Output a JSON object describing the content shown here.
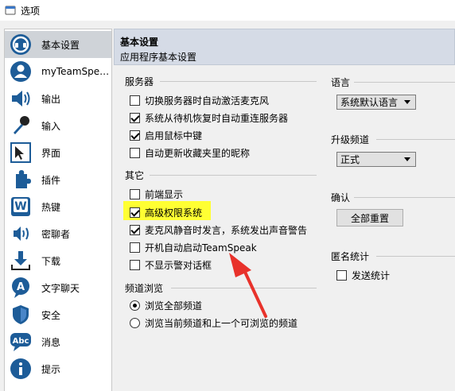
{
  "window": {
    "title": "选项"
  },
  "sidebar": {
    "items": [
      {
        "label": "基本设置",
        "icon": "teamspeak-logo-icon",
        "selected": true
      },
      {
        "label": "myTeamSpe…",
        "icon": "user-avatar-icon"
      },
      {
        "label": "输出",
        "icon": "speaker-icon"
      },
      {
        "label": "输入",
        "icon": "microphone-icon"
      },
      {
        "label": "界面",
        "icon": "pointer-icon"
      },
      {
        "label": "插件",
        "icon": "puzzle-icon"
      },
      {
        "label": "热键",
        "icon": "keyboard-key-icon"
      },
      {
        "label": "密聊者",
        "icon": "whisper-icon"
      },
      {
        "label": "下载",
        "icon": "download-icon"
      },
      {
        "label": "文字聊天",
        "icon": "text-chat-icon"
      },
      {
        "label": "安全",
        "icon": "shield-icon"
      },
      {
        "label": "消息",
        "icon": "abc-bubble-icon"
      },
      {
        "label": "提示",
        "icon": "info-icon"
      }
    ]
  },
  "header": {
    "title": "基本设置",
    "subtitle": "应用程序基本设置"
  },
  "server_group": {
    "title": "服务器",
    "options": [
      {
        "label": "切换服务器时自动激活麦克风",
        "checked": false
      },
      {
        "label": "系统从待机恢复时自动重连服务器",
        "checked": true
      },
      {
        "label": "启用鼠标中键",
        "checked": true
      },
      {
        "label": "自动更新收藏夹里的昵称",
        "checked": false
      }
    ]
  },
  "other_group": {
    "title": "其它",
    "options": [
      {
        "label": "前端显示",
        "checked": false
      },
      {
        "label": "高级权限系统",
        "checked": true
      },
      {
        "label": "麦克风静音时发言，系统发出声音警告",
        "checked": true
      },
      {
        "label": "开机自动启动TeamSpeak",
        "checked": false
      },
      {
        "label": "不显示警对话框",
        "checked": false
      }
    ]
  },
  "channel_group": {
    "title": "频道浏览",
    "options": [
      {
        "label": "浏览全部频道",
        "selected": true
      },
      {
        "label": "浏览当前频道和上一个可浏览的频道",
        "selected": false
      }
    ]
  },
  "language_group": {
    "title": "语言",
    "selected": "系统默认语言"
  },
  "upgrade_group": {
    "title": "升级频道",
    "selected": "正式"
  },
  "confirm_group": {
    "title": "确认",
    "button_label": "全部重置"
  },
  "stats_group": {
    "title": "匿名统计",
    "option": {
      "label": "发送统计",
      "checked": false
    }
  },
  "colors": {
    "highlight": "#ffff33",
    "arrow": "#e8322b",
    "header_bg": "#d5dbe6",
    "selected_bg": "#cfd3d8"
  }
}
